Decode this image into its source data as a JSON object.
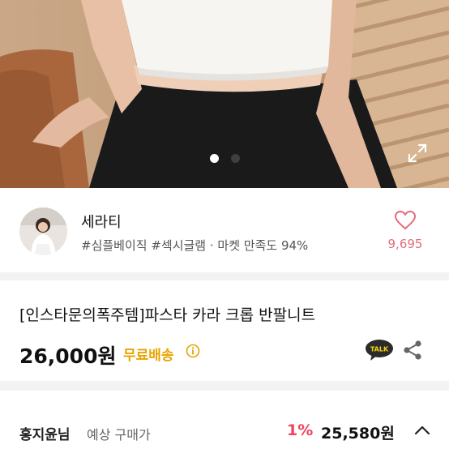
{
  "seller": {
    "name": "세라티",
    "tags": "#심플베이직 #섹시글램 · 마켓 만족도 94%",
    "likes": "9,695"
  },
  "gallery": {
    "slide_count": 2,
    "active_slide": 1
  },
  "product": {
    "title": "[인스타문의폭주템]파스타 카라 크롭 반팔니트",
    "price": "26,000원",
    "shipping": "무료배송",
    "talk_badge": "TALK"
  },
  "buyer": {
    "name": "홍지윤님",
    "label": "예상 구매가",
    "discount": "1%",
    "price": "25,580원"
  },
  "colors": {
    "accent_pink": "#e46b7a",
    "shipping_yellow": "#e8a400",
    "discount_red": "#f0435c",
    "talk_yellow": "#f7d417"
  },
  "icons": [
    "expand-icon",
    "heart-icon",
    "info-icon",
    "talk-icon",
    "share-icon",
    "chevron-up-icon"
  ]
}
